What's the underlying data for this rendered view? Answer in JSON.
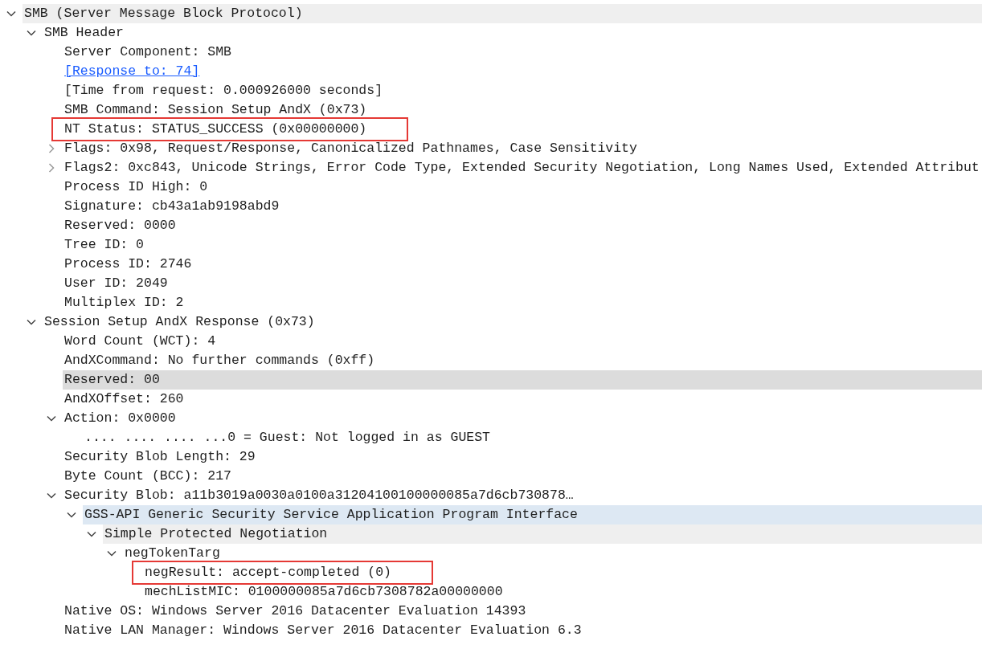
{
  "tree": [
    {
      "label": "SMB (Server Message Block Protocol)",
      "expanded": true,
      "kind": "ancestor",
      "selected": false,
      "children": [
        {
          "label": "SMB Header",
          "expanded": true,
          "selected": false,
          "children": [
            {
              "label": "Server Component: SMB",
              "selected": false
            },
            {
              "label": "[Response to: 74]",
              "kind": "link",
              "selected": false
            },
            {
              "label": "[Time from request: 0.000926000 seconds]",
              "selected": false
            },
            {
              "label": "SMB Command: Session Setup AndX (0x73)",
              "selected": false
            },
            {
              "label": "NT Status: STATUS_SUCCESS (0x00000000)",
              "boxed": true,
              "selected": false
            },
            {
              "label": "Flags: 0x98, Request/Response, Canonicalized Pathnames, Case Sensitivity",
              "expanded": false,
              "selected": false
            },
            {
              "label": "Flags2: 0xc843, Unicode Strings, Error Code Type, Extended Security Negotiation, Long Names Used, Extended Attribut",
              "expanded": false,
              "selected": false
            },
            {
              "label": "Process ID High: 0",
              "selected": false
            },
            {
              "label": "Signature: cb43a1ab9198abd9",
              "selected": false
            },
            {
              "label": "Reserved: 0000",
              "selected": false
            },
            {
              "label": "Tree ID: 0",
              "selected": false
            },
            {
              "label": "Process ID: 2746",
              "selected": false
            },
            {
              "label": "User ID: 2049",
              "selected": false
            },
            {
              "label": "Multiplex ID: 2",
              "selected": false
            }
          ]
        },
        {
          "label": "Session Setup AndX Response (0x73)",
          "expanded": true,
          "selected": false,
          "children": [
            {
              "label": "Word Count (WCT): 4",
              "selected": false
            },
            {
              "label": "AndXCommand: No further commands (0xff)",
              "selected": false
            },
            {
              "label": "Reserved: 00",
              "selected": true
            },
            {
              "label": "AndXOffset: 260",
              "selected": false
            },
            {
              "label": "Action: 0x0000",
              "expanded": true,
              "selected": false,
              "children": [
                {
                  "label": ".... .... .... ...0 = Guest: Not logged in as GUEST",
                  "selected": false
                }
              ]
            },
            {
              "label": "Security Blob Length: 29",
              "selected": false
            },
            {
              "label": "Byte Count (BCC): 217",
              "selected": false
            },
            {
              "label": "Security Blob: a11b3019a0030a0100a31204100100000085a7d6cb730878…",
              "expanded": true,
              "selected": false,
              "children": [
                {
                  "label": "GSS-API Generic Security Service Application Program Interface",
                  "expanded": true,
                  "kind": "related",
                  "selected": false,
                  "children": [
                    {
                      "label": "Simple Protected Negotiation",
                      "expanded": true,
                      "kind": "ancestor",
                      "selected": false,
                      "children": [
                        {
                          "label": "negTokenTarg",
                          "expanded": true,
                          "selected": false,
                          "children": [
                            {
                              "label": "negResult: accept-completed (0)",
                              "boxed": true,
                              "selected": false
                            },
                            {
                              "label": "mechListMIC: 0100000085a7d6cb7308782a00000000",
                              "selected": false
                            }
                          ]
                        }
                      ]
                    }
                  ]
                }
              ]
            },
            {
              "label": "Native OS: Windows Server 2016 Datacenter Evaluation 14393",
              "selected": false
            },
            {
              "label": "Native LAN Manager: Windows Server 2016 Datacenter Evaluation 6.3",
              "selected": false
            }
          ]
        }
      ]
    }
  ]
}
